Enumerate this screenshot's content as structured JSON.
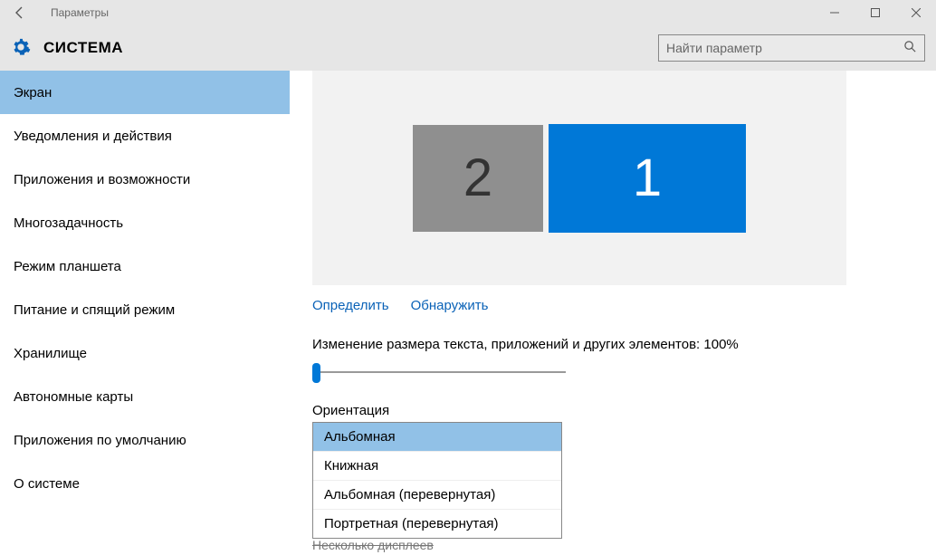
{
  "window": {
    "title": "Параметры"
  },
  "header": {
    "title": "СИСТЕМА",
    "search_placeholder": "Найти параметр"
  },
  "sidebar": {
    "items": [
      {
        "label": "Экран",
        "selected": true
      },
      {
        "label": "Уведомления и действия",
        "selected": false
      },
      {
        "label": "Приложения и возможности",
        "selected": false
      },
      {
        "label": "Многозадачность",
        "selected": false
      },
      {
        "label": "Режим планшета",
        "selected": false
      },
      {
        "label": "Питание и спящий режим",
        "selected": false
      },
      {
        "label": "Хранилище",
        "selected": false
      },
      {
        "label": "Автономные карты",
        "selected": false
      },
      {
        "label": "Приложения по умолчанию",
        "selected": false
      },
      {
        "label": "О системе",
        "selected": false
      }
    ]
  },
  "display": {
    "monitors": {
      "secondary": "2",
      "primary": "1"
    },
    "identify_label": "Определить",
    "detect_label": "Обнаружить",
    "scale_label": "Изменение размера текста, приложений и других элементов: 100%",
    "orientation_label": "Ориентация",
    "orientation_options": [
      {
        "label": "Альбомная",
        "selected": true
      },
      {
        "label": "Книжная",
        "selected": false
      },
      {
        "label": "Альбомная (перевернутая)",
        "selected": false
      },
      {
        "label": "Портретная (перевернутая)",
        "selected": false
      }
    ],
    "multi_display_label": "Несколько дисплеев"
  }
}
